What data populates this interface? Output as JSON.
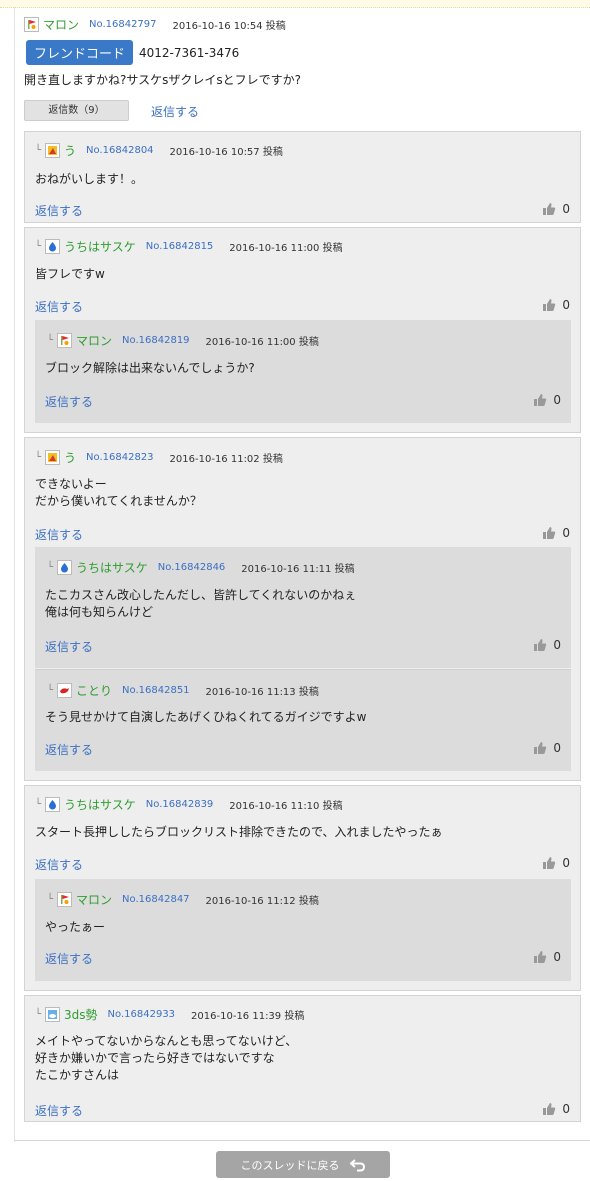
{
  "main_post": {
    "name": "マロン",
    "number": "No.16842797",
    "date": "2016-10-16 10:54 投稿",
    "friend_code_label": "フレンドコード",
    "friend_code": "4012-7361-3476",
    "body": "開き直しますかね?サスケsザクレイsとフレですか?",
    "reply_count_label": "返信数（9）",
    "reply_label": "返信する"
  },
  "replies": [
    {
      "name": "う",
      "number": "No.16842804",
      "date": "2016-10-16 10:57 投稿",
      "lines": [
        "おねがいします！。"
      ],
      "reply_label": "返信する",
      "likes": "0"
    },
    {
      "name": "うちはサスケ",
      "number": "No.16842815",
      "date": "2016-10-16 11:00 投稿",
      "lines": [
        "皆フレですw"
      ],
      "reply_label": "返信する",
      "likes": "0",
      "sub": [
        {
          "name": "マロン",
          "number": "No.16842819",
          "date": "2016-10-16 11:00 投稿",
          "lines": [
            "ブロック解除は出来ないんでしょうか?"
          ],
          "reply_label": "返信する",
          "likes": "0"
        }
      ]
    },
    {
      "name": "う",
      "number": "No.16842823",
      "date": "2016-10-16 11:02 投稿",
      "lines": [
        "できないよー",
        "だから僕いれてくれませんか？"
      ],
      "reply_label": "返信する",
      "likes": "0",
      "sub": [
        {
          "name": "うちはサスケ",
          "number": "No.16842846",
          "date": "2016-10-16 11:11 投稿",
          "lines": [
            "たこカスさん改心したんだし、皆許してくれないのかねぇ",
            "俺は何も知らんけど"
          ],
          "reply_label": "返信する",
          "likes": "0"
        },
        {
          "name": "ことり",
          "number": "No.16842851",
          "date": "2016-10-16 11:13 投稿",
          "lines": [
            "そう見せかけて自演したあげくひねくれてるガイジですよw"
          ],
          "reply_label": "返信する",
          "likes": "0"
        }
      ]
    },
    {
      "name": "うちはサスケ",
      "number": "No.16842839",
      "date": "2016-10-16 11:10 投稿",
      "lines": [
        "スタート長押ししたらブロックリスト排除できたので、入れましたやったぁ"
      ],
      "reply_label": "返信する",
      "likes": "0",
      "sub": [
        {
          "name": "マロン",
          "number": "No.16842847",
          "date": "2016-10-16 11:12 投稿",
          "lines": [
            "やったぁー"
          ],
          "reply_label": "返信する",
          "likes": "0"
        }
      ]
    },
    {
      "name": "3ds勢",
      "number": "No.16842933",
      "date": "2016-10-16 11:39 投稿",
      "lines": [
        "メイトやってないからなんとも思ってないけど、",
        "好きか嫌いかで言ったら好きではないですな",
        "たこかすさんは"
      ],
      "reply_label": "返信する",
      "likes": "0"
    }
  ],
  "back_button_label": "このスレッドに戻る",
  "icons": {
    "marron": "flag-avatar-icon",
    "u": "yellow-avatar-icon",
    "sasuke": "blue-drop-avatar-icon",
    "kotori": "red-bird-avatar-icon",
    "3ds": "blue-cloud-avatar-icon",
    "thumb": "thumbs-up-icon",
    "return": "return-arrow-icon"
  },
  "colors": {
    "name": "#2e9c2e",
    "link": "#3a6fc4",
    "friend_code_button": "#3a78c8",
    "back_button": "#a5a5a5"
  }
}
